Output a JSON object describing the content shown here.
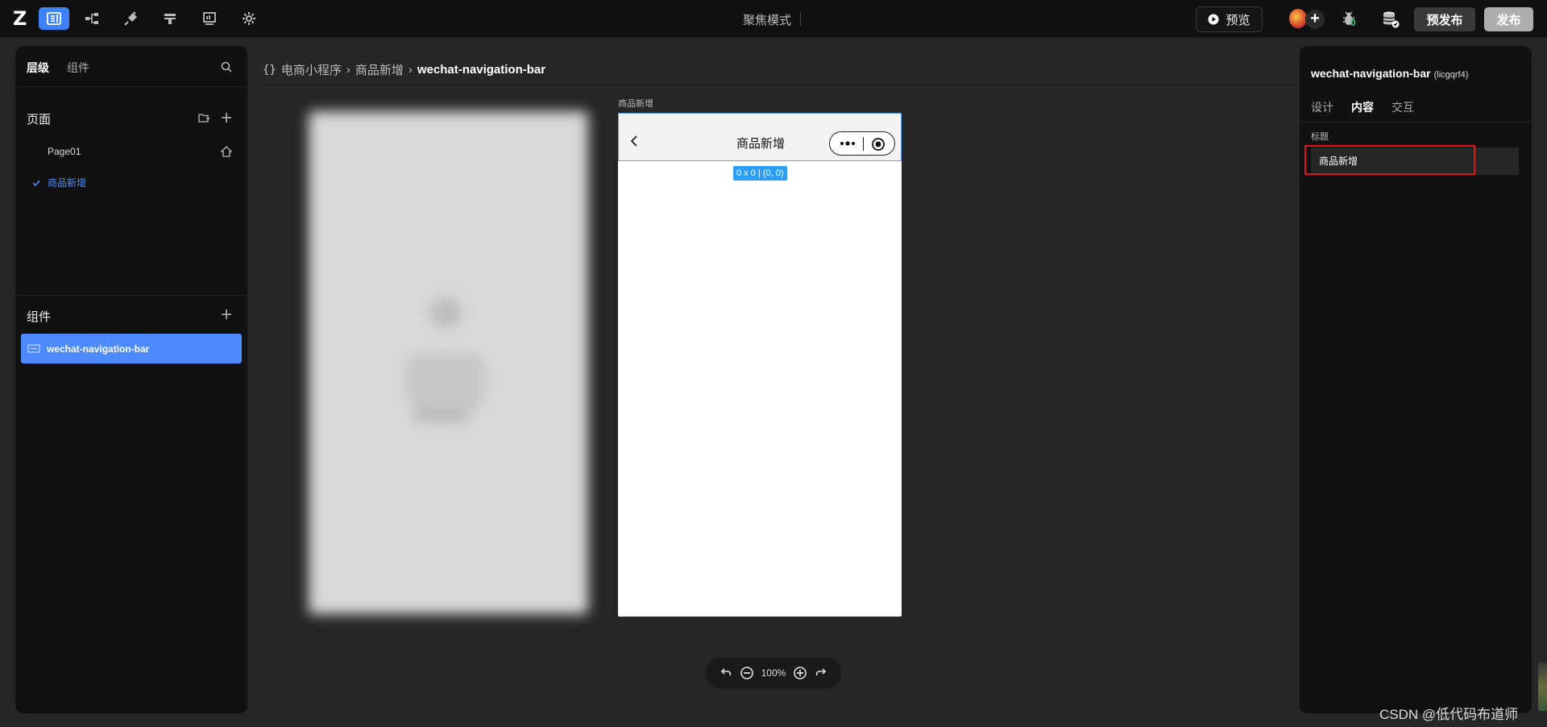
{
  "topbar": {
    "logo": "Z",
    "mode_label": "聚焦模式",
    "preview_label": "预览",
    "bug_count": "0",
    "prepublish_label": "预发布",
    "publish_label": "发布"
  },
  "left_panel": {
    "tabs": [
      "层级",
      "组件"
    ],
    "pages_title": "页面",
    "pages": [
      {
        "label": "Page01",
        "active": false
      },
      {
        "label": "商品新增",
        "active": true
      }
    ],
    "components_title": "组件",
    "component_item": "wechat-navigation-bar"
  },
  "breadcrumb": {
    "app": "电商小程序",
    "page": "商品新增",
    "current": "wechat-navigation-bar"
  },
  "canvas": {
    "frame_label": "商品新增",
    "nav_title": "商品新增",
    "size_badge": "0 x 0 | (0, 0)",
    "zoom": "100%"
  },
  "right_panel": {
    "title": "wechat-navigation-bar",
    "id": "(licgqrf4)",
    "tabs": [
      "设计",
      "内容",
      "交互"
    ],
    "active_tab": "内容",
    "field_label": "标题",
    "field_value": "商品新增"
  },
  "watermark": "CSDN @低代码布道师",
  "colors": {
    "accent": "#4d8afb",
    "highlight": "#e0141a",
    "badge": "#2c9ef5"
  }
}
